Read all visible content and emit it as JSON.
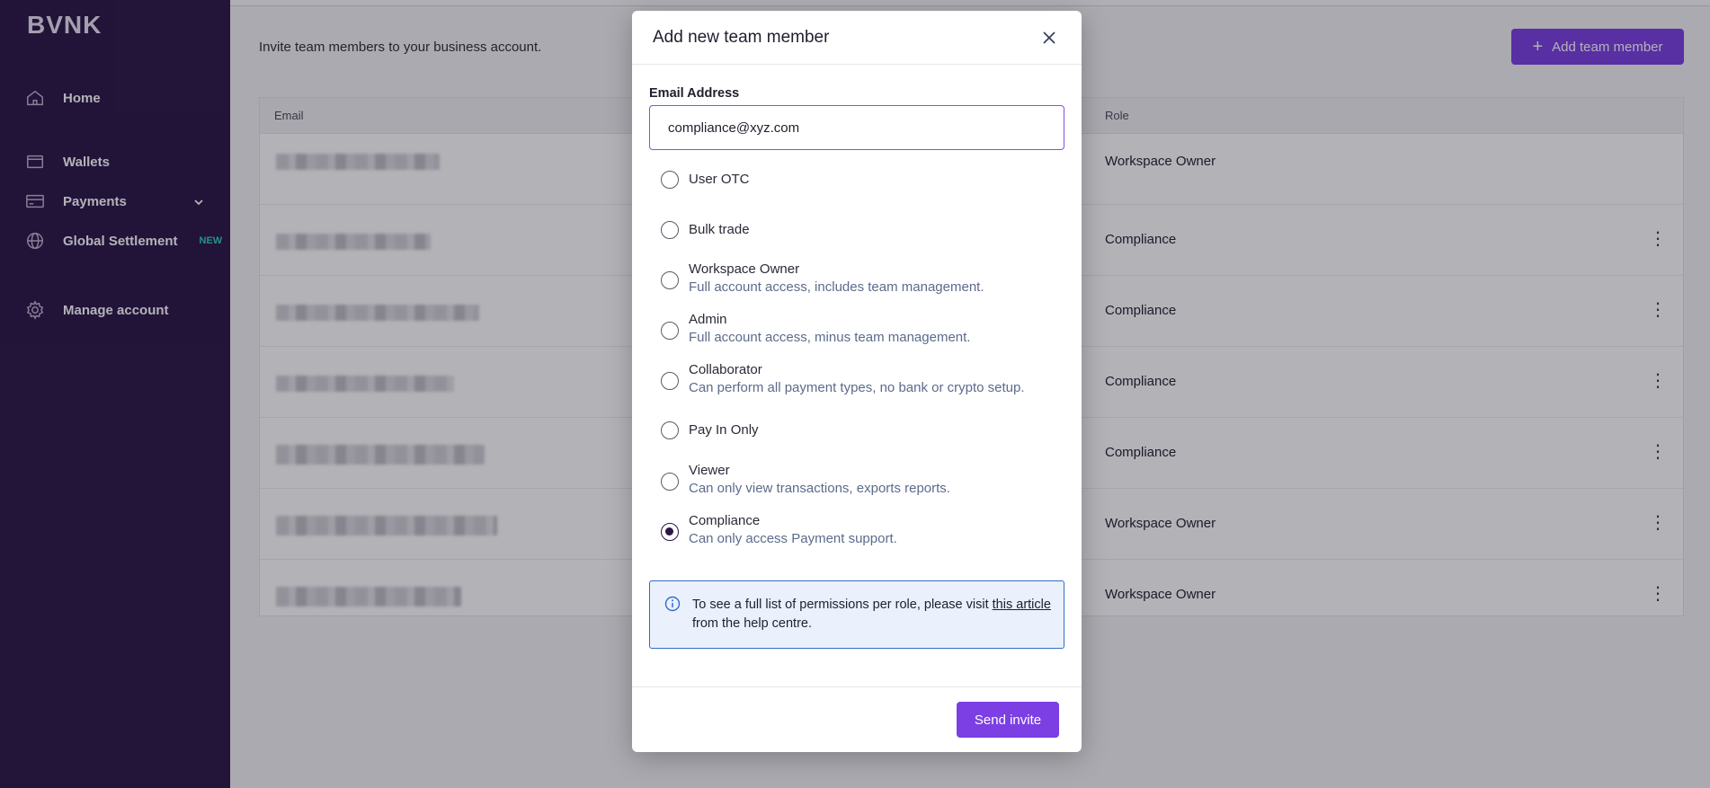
{
  "sidebar": {
    "logo": "BVNK",
    "items": [
      {
        "label": "Home"
      },
      {
        "label": "Wallets"
      },
      {
        "label": "Payments"
      },
      {
        "label": "Global Settlement",
        "badge": "NEW"
      },
      {
        "label": "Manage account"
      }
    ]
  },
  "main": {
    "intro": "Invite team members to your business account.",
    "add_button": "Add team member",
    "table": {
      "headers": {
        "email": "Email",
        "role": "Role"
      },
      "rows": [
        {
          "role": "Workspace Owner"
        },
        {
          "role": "Compliance"
        },
        {
          "role": "Compliance"
        },
        {
          "role": "Compliance"
        },
        {
          "role": "Compliance"
        },
        {
          "role": "Workspace Owner"
        },
        {
          "role": "Workspace Owner"
        }
      ]
    }
  },
  "modal": {
    "title": "Add new team member",
    "email_label": "Email Address",
    "email_value": "compliance@xyz.com",
    "options": [
      {
        "title": "User OTC",
        "desc": ""
      },
      {
        "title": "Bulk trade",
        "desc": ""
      },
      {
        "title": "Workspace Owner",
        "desc": "Full account access, includes team management."
      },
      {
        "title": "Admin",
        "desc": "Full account access, minus team management."
      },
      {
        "title": "Collaborator",
        "desc": "Can perform all payment types, no bank or crypto setup."
      },
      {
        "title": "Pay In Only",
        "desc": ""
      },
      {
        "title": "Viewer",
        "desc": "Can only view transactions, exports reports."
      },
      {
        "title": "Compliance",
        "desc": "Can only access Payment support."
      }
    ],
    "selected_option": "Compliance",
    "info": {
      "prefix": "To see a full list of permissions per role, please visit ",
      "link": "this article",
      "suffix": " from the help centre."
    },
    "send_button": "Send invite"
  },
  "colors": {
    "sidebar_bg": "#2a1646",
    "accent": "#7b3fe4",
    "info_border": "#2f6cc8"
  }
}
